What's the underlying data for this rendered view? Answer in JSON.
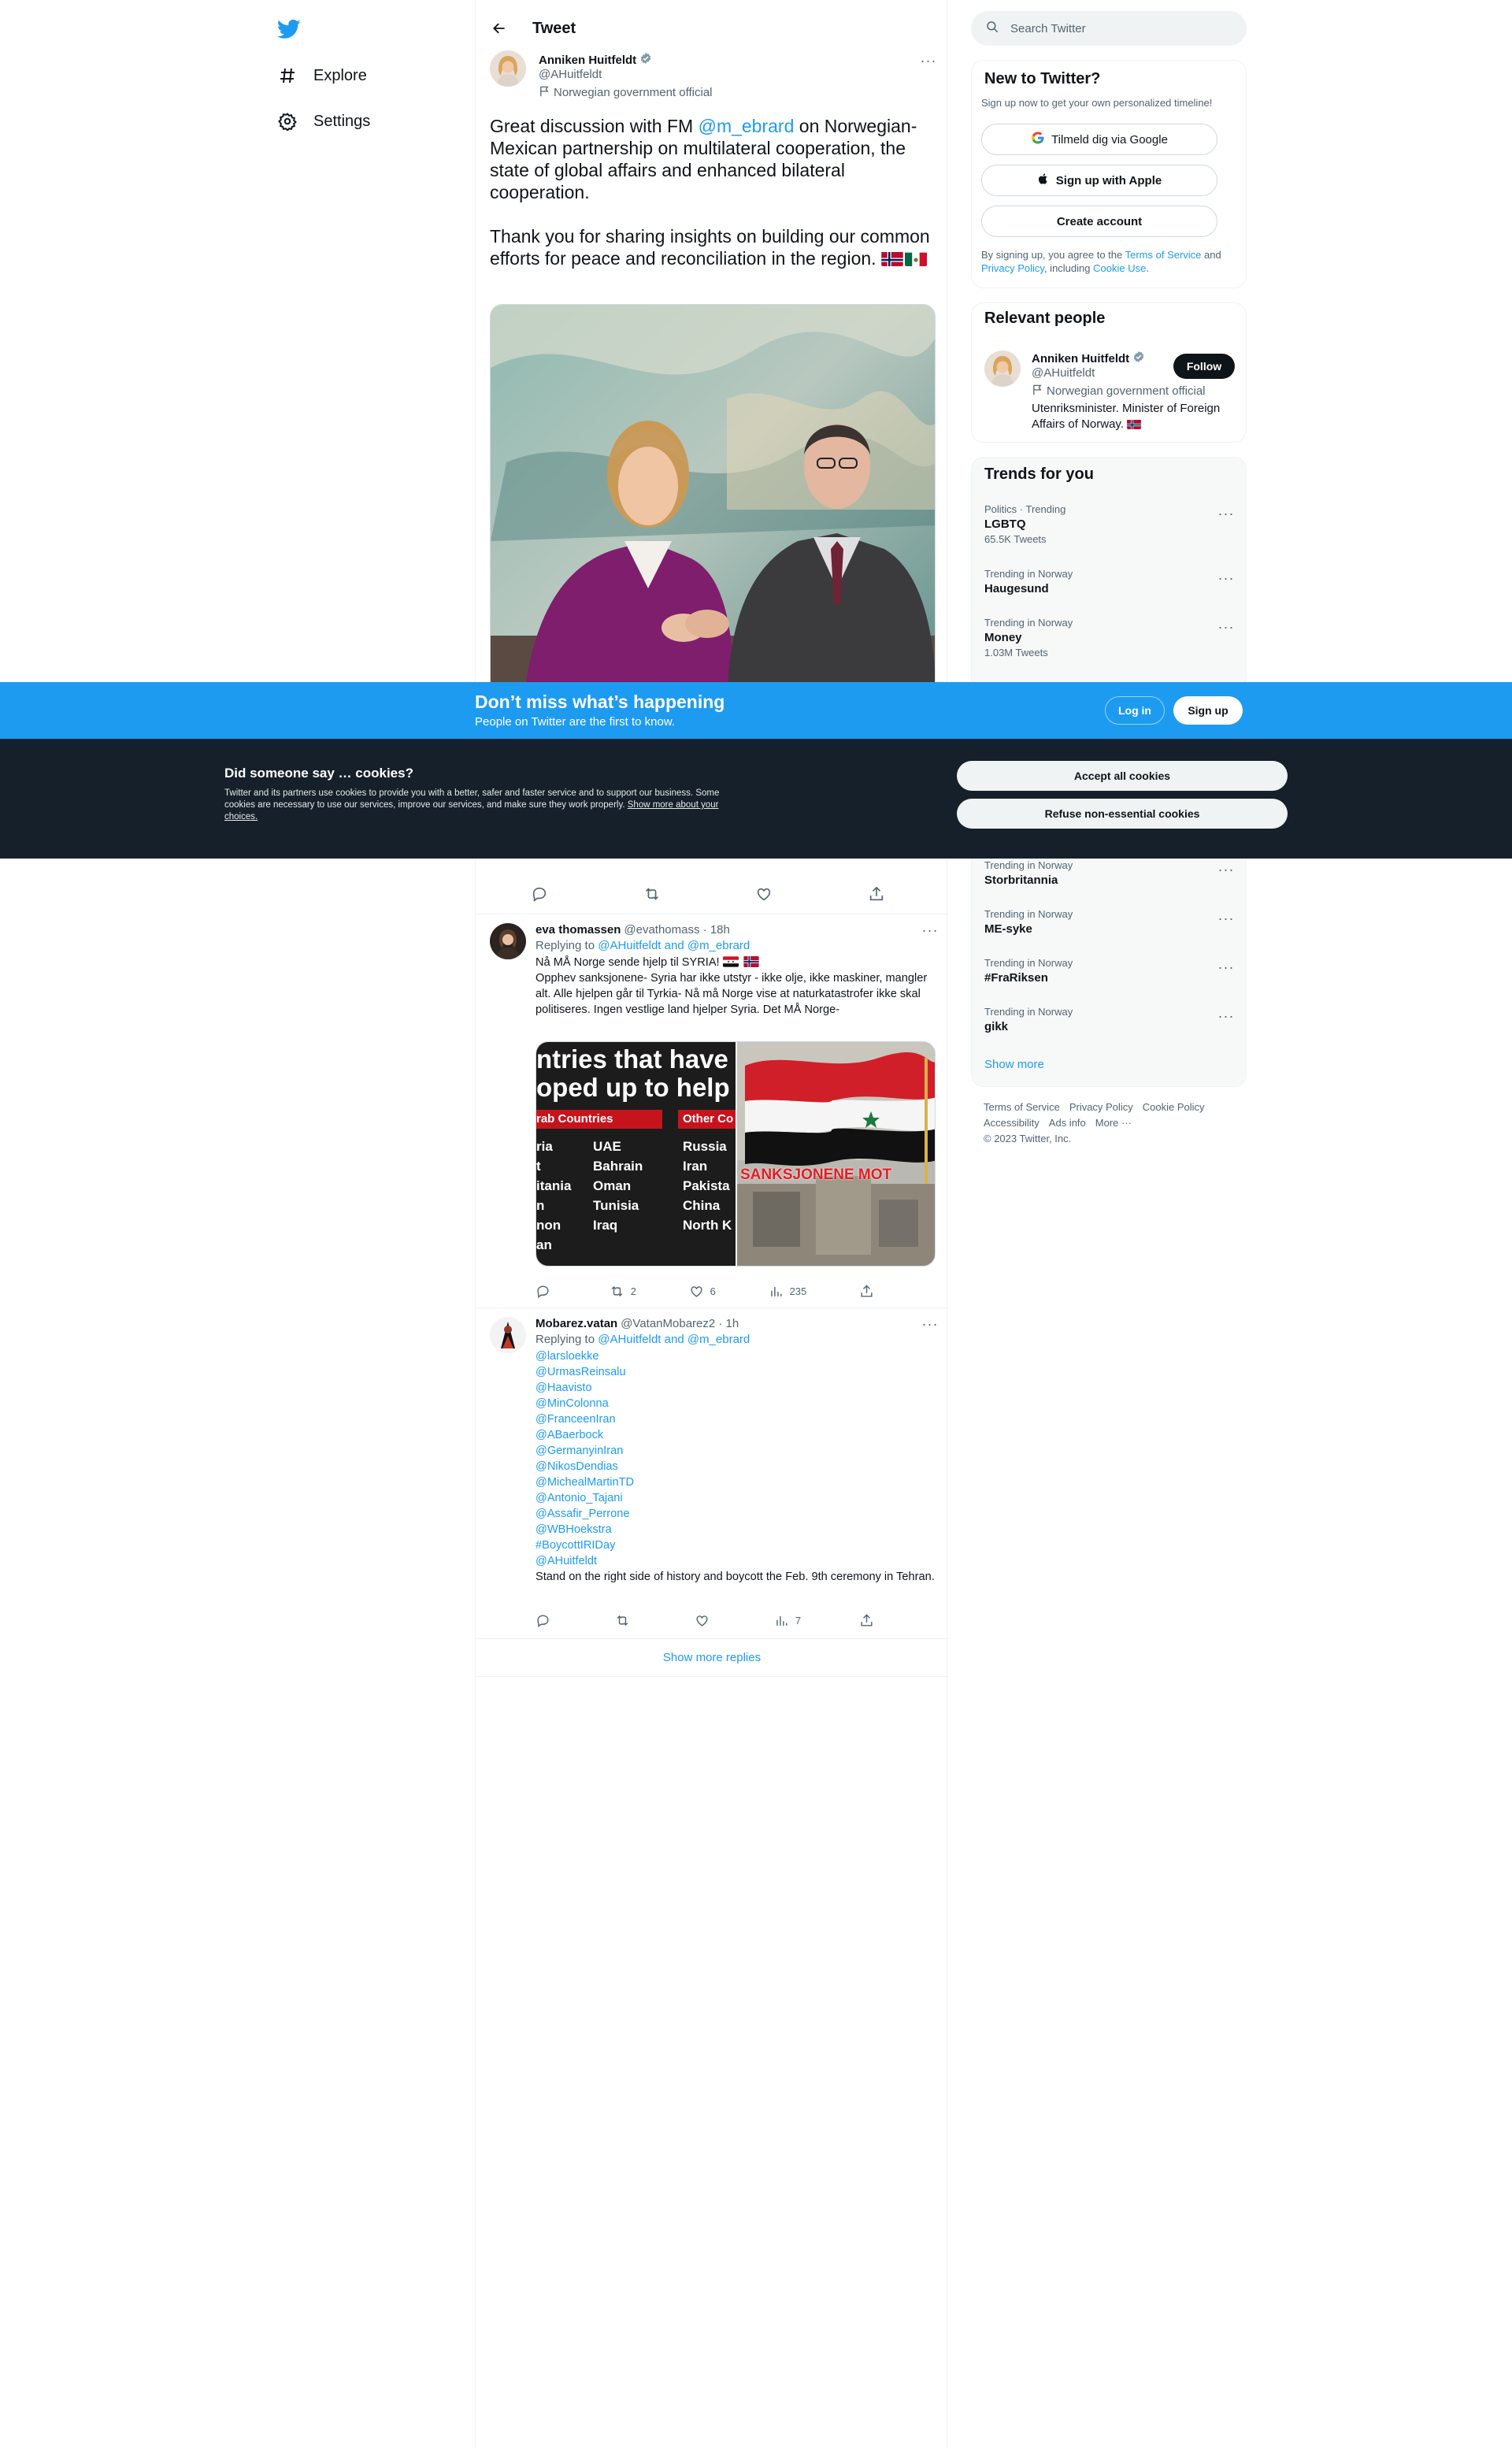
{
  "nav": {
    "logo": "twitter-bird",
    "items": [
      {
        "label": "Explore",
        "icon": "hashtag-icon"
      },
      {
        "label": "Settings",
        "icon": "gear-icon"
      }
    ]
  },
  "main": {
    "title": "Tweet",
    "tweet": {
      "name": "Anniken Huitfeldt",
      "handle": "@AHuitfeldt",
      "label": "Norwegian government official",
      "text_before": "Great discussion with FM ",
      "mention": "@m_ebrard",
      "text_after": " on Norwegian-Mexican partnership on multilateral cooperation, the state of global affairs and enhanced bilateral cooperation.",
      "text2": "Thank you for sharing insights on building our common efforts for peace and reconciliation in the region. "
    },
    "replies": [
      {
        "name": "eva thomassen",
        "meta": "@evathomass · 18h",
        "replying_prefix": "Replying to ",
        "replying_to": "@AHuitfeldt and @m_ebrard",
        "line1": "Nå MÅ Norge sende hjelp til SYRIA!",
        "line2": "Opphev sanksjonene- Syria har ikke utstyr - ikke olje, ikke maskiner, mangler alt. Alle hjelpen går til Tyrkia- Nå må Norge vise at naturkatastrofer ikke skal politiseres. Ingen vestlige land hjelper Syria. Det MÅ Norge-",
        "media": {
          "headline1": "ntries that have",
          "headline2": "oped up to help S",
          "col1_head": "rab Countries",
          "col2_head": "Other Co",
          "col1": [
            "ria",
            "t",
            "itania",
            "n",
            "non",
            "an"
          ],
          "col2": [
            "UAE",
            "Bahrain",
            "Oman",
            "Tunisia",
            "Iraq"
          ],
          "col3": [
            "Russia",
            "Iran",
            "Pakista",
            "China",
            "North K"
          ],
          "banner": "SANKSJONENE MOT"
        },
        "stats": {
          "reply": "",
          "retweet": "2",
          "like": "6",
          "views": "235"
        }
      },
      {
        "name": "Mobarez.vatan",
        "meta": "@VatanMobarez2 · 1h",
        "replying_prefix": "Replying to ",
        "replying_to": "@AHuitfeldt and @m_ebrard",
        "mentions": [
          "@larsloekke",
          "@UrmasReinsalu",
          "@Haavisto",
          "@MinColonna",
          "@FranceenIran",
          "@ABaerbock",
          "@GermanyinIran",
          "@NikosDendias",
          "@MichealMartinTD",
          "@Antonio_Tajani",
          "@Assafir_Perrone",
          "@WBHoekstra",
          "#BoycottIRIDay",
          "@AHuitfeldt"
        ],
        "text": "Stand on the right side of history and boycott the Feb. 9th ceremony in Tehran.",
        "stats": {
          "reply": "",
          "retweet": "",
          "like": "",
          "views": "7"
        }
      }
    ],
    "show_more_replies": "Show more replies"
  },
  "sidebar": {
    "search_placeholder": "Search Twitter",
    "signup": {
      "title": "New to Twitter?",
      "subtitle": "Sign up now to get your own personalized timeline!",
      "google": "Tilmeld dig via Google",
      "apple": "Sign up with Apple",
      "create": "Create account",
      "legal_1": "By signing up, you agree to the ",
      "tos": "Terms of Service",
      "legal_2": " and ",
      "privacy": "Privacy Policy",
      "legal_3": ", including ",
      "cookie": "Cookie Use",
      "legal_4": "."
    },
    "relevant": {
      "title": "Relevant people",
      "name": "Anniken Huitfeldt",
      "handle": "@AHuitfeldt",
      "label": "Norwegian government official",
      "bio": "Utenriksminister. Minister of Foreign Affairs of Norway. ",
      "follow": "Follow"
    },
    "trends": {
      "title": "Trends for you",
      "items": [
        {
          "context": "Politics · Trending",
          "name": "LGBTQ",
          "count": "65.5K Tweets"
        },
        {
          "context": "Trending in Norway",
          "name": "Haugesund",
          "count": ""
        },
        {
          "context": "Trending in Norway",
          "name": "Money",
          "count": "1.03M Tweets"
        },
        {
          "context": "Trending in Norway",
          "name": "Storbritannia",
          "count": ""
        },
        {
          "context": "Trending in Norway",
          "name": "ME-syke",
          "count": ""
        },
        {
          "context": "Trending in Norway",
          "name": "#FraRiksen",
          "count": ""
        },
        {
          "context": "Trending in Norway",
          "name": "gikk",
          "count": ""
        }
      ],
      "show_more": "Show more"
    },
    "footer": [
      "Terms of Service",
      "Privacy Policy",
      "Cookie Policy",
      "Accessibility",
      "Ads info",
      "More ···",
      "© 2023 Twitter, Inc."
    ]
  },
  "login_bar": {
    "title": "Don’t miss what’s happening",
    "subtitle": "People on Twitter are the first to know.",
    "login": "Log in",
    "signup": "Sign up"
  },
  "cookie_bar": {
    "title": "Did someone say … cookies?",
    "text": "Twitter and its partners use cookies to provide you with a better, safer and faster service and to support our business. Some cookies are necessary to use our services, improve our services, and make sure they work properly. ",
    "link": "Show more about your choices.",
    "accept": "Accept all cookies",
    "refuse": "Refuse non-essential cookies"
  },
  "colors": {
    "accent": "#1d9bf0",
    "cookie_bg": "#15202b",
    "text": "#0f1419",
    "muted": "#536471"
  }
}
